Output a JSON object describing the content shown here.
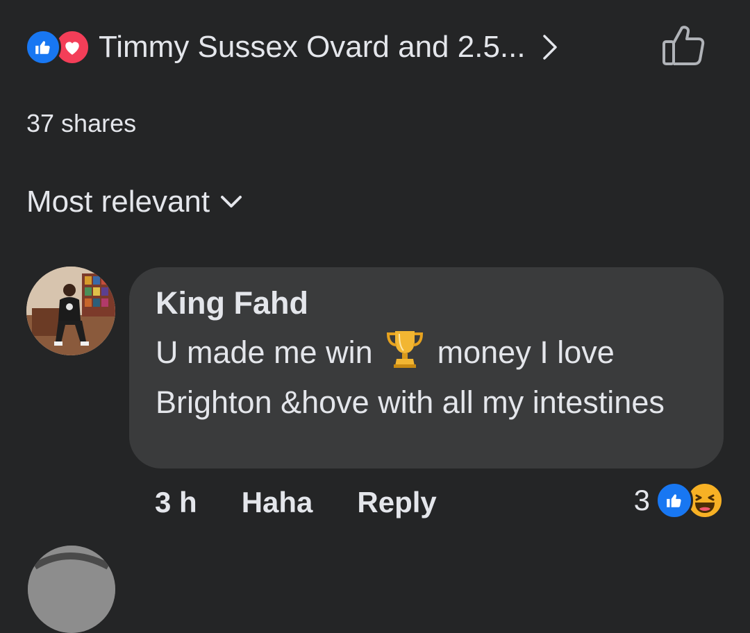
{
  "header": {
    "reactors_text": "Timmy Sussex Ovard and 2.5...",
    "reaction_icons": [
      "like-icon",
      "love-icon"
    ],
    "like_button_icon": "thumbs-up-outline-icon"
  },
  "shares_text": "37 shares",
  "sort": {
    "label": "Most relevant",
    "icon": "chevron-down-icon"
  },
  "comment": {
    "author": "King Fahd",
    "text_before_emoji": "U made me win",
    "emoji": "trophy-icon",
    "text_after_emoji": "money I love Brighton &hove with all my intestines",
    "time": "3 h",
    "haha_label": "Haha",
    "reply_label": "Reply",
    "reaction_count": "3",
    "reaction_icons": [
      "like-icon",
      "haha-icon"
    ]
  },
  "colors": {
    "background": "#242526",
    "bubble": "#3a3b3c",
    "text": "#e4e6eb",
    "like_blue": "#1877f2",
    "love_red": "#f33e58",
    "haha_yellow": "#f7b125"
  }
}
